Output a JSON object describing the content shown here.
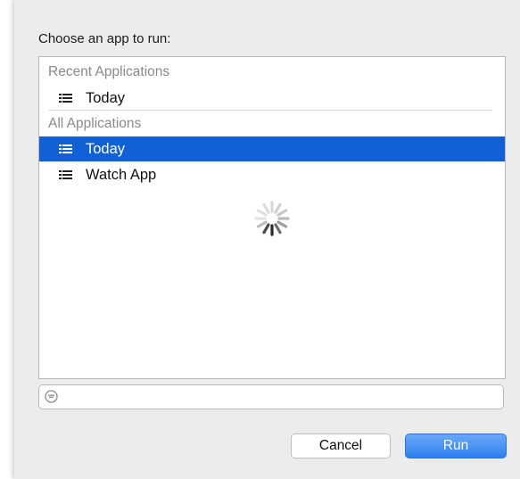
{
  "dialog": {
    "prompt": "Choose an app to run:",
    "sections": [
      {
        "header": "Recent Applications",
        "items": [
          {
            "label": "Today",
            "icon": "list-icon",
            "selected": false
          }
        ]
      },
      {
        "header": "All Applications",
        "items": [
          {
            "label": "Today",
            "icon": "list-icon",
            "selected": true
          },
          {
            "label": "Watch App",
            "icon": "list-icon",
            "selected": false
          }
        ]
      }
    ],
    "loading": true,
    "search": {
      "value": "",
      "placeholder": ""
    },
    "buttons": {
      "cancel": "Cancel",
      "run": "Run"
    },
    "colors": {
      "selection": "#1160d8",
      "primary_button": "#3a88f2"
    }
  }
}
